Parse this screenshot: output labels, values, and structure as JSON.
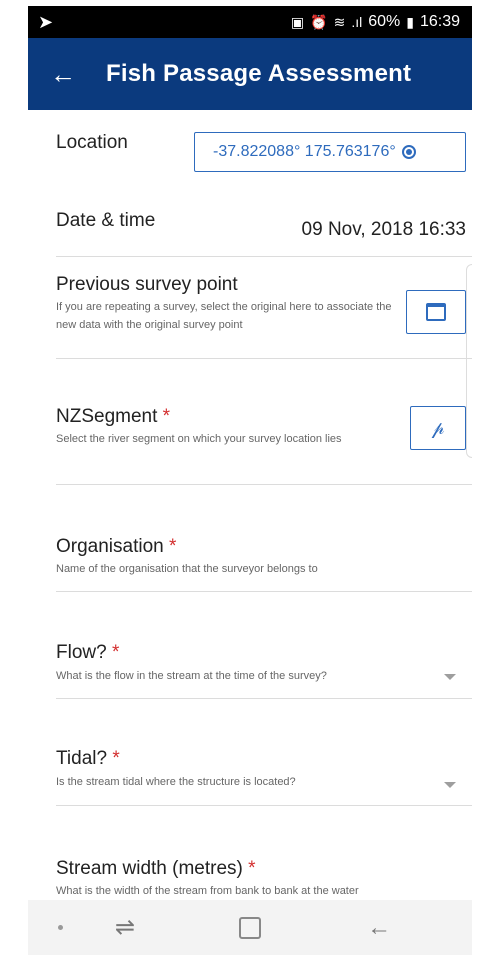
{
  "status_bar": {
    "battery_percent": "60%",
    "time": "16:39"
  },
  "app_bar": {
    "title": "Fish Passage Assessment"
  },
  "form": {
    "location": {
      "label": "Location",
      "value": "-37.822088° 175.763176°"
    },
    "datetime": {
      "label": "Date & time",
      "value": "09 Nov, 2018 16:33"
    },
    "previous_survey": {
      "label": "Previous survey point",
      "help": "If you are repeating a survey, select the original here to associate the new data with the original survey point"
    },
    "nzsegment": {
      "label": "NZSegment",
      "required": "*",
      "help": "Select the river segment on which your survey location lies"
    },
    "organisation": {
      "label": "Organisation",
      "required": "*",
      "help": "Name of the organisation that the surveyor belongs to"
    },
    "flow": {
      "label": "Flow?",
      "required": "*",
      "help": "What is the flow in the stream at the time of the survey?"
    },
    "tidal": {
      "label": "Tidal?",
      "required": "*",
      "help": "Is the stream tidal where the structure is located?"
    },
    "stream_width": {
      "label": "Stream width (metres)",
      "required": "*",
      "help": "What is the width of the stream from bank to bank at the water"
    }
  },
  "colors": {
    "app_bar": "#0b3a7e",
    "accent": "#2e6bbd",
    "required": "#d32f2f"
  }
}
